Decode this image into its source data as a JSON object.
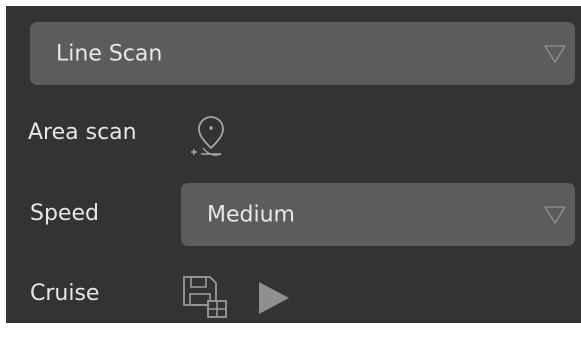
{
  "scan_mode": {
    "selected": "Line Scan",
    "icon": "chevron-down-icon"
  },
  "area_scan": {
    "label": "Area scan",
    "icon": "map-pin-add-icon"
  },
  "speed": {
    "label": "Speed",
    "selected": "Medium",
    "icon": "chevron-down-icon"
  },
  "cruise": {
    "label": "Cruise",
    "save_icon": "save-grid-icon",
    "play_icon": "play-icon"
  },
  "colors": {
    "panel_bg": "#333333",
    "control_bg": "#5c5c5c",
    "text": "#e6e6e6",
    "icon": "#9a9a9a"
  }
}
